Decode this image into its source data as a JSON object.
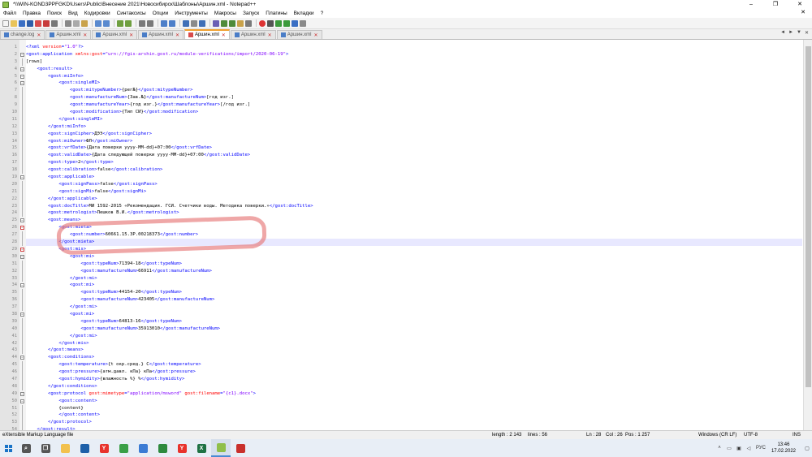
{
  "window": {
    "title": "*\\\\WIN-KOND3PPFGKD\\Users\\Public\\Внесение 2021\\Новосибирск\\Шаблоны\\Аршин.xml - Notepad++",
    "controls": [
      "–",
      "❐",
      "✕"
    ]
  },
  "menu": [
    "Файл",
    "Правка",
    "Поиск",
    "Вид",
    "Кодировки",
    "Синтаксисы",
    "Опции",
    "Инструменты",
    "Макросы",
    "Запуск",
    "Плагины",
    "Вкладки",
    "?"
  ],
  "menu_close": "✕",
  "tabs": [
    {
      "label": "change.log"
    },
    {
      "label": "Аршин.xml"
    },
    {
      "label": "Аршин.xml"
    },
    {
      "label": "Аршин.xml"
    },
    {
      "label": "Аршин.xml"
    },
    {
      "label": "Аршин.xml"
    },
    {
      "label": "Аршин.xml"
    }
  ],
  "tab_nav": [
    "◄",
    "►",
    "▼",
    "✕"
  ],
  "code_lines": [
    {
      "n": "1",
      "tokens": [
        {
          "c": "tag",
          "t": "<?xml "
        },
        {
          "c": "attr",
          "t": "version"
        },
        {
          "c": "tag",
          "t": "="
        },
        {
          "c": "val",
          "t": "\"1.0\""
        },
        {
          "c": "tag",
          "t": "?>"
        }
      ]
    },
    {
      "n": "2",
      "tokens": [
        {
          "c": "tag",
          "t": "<gost:application "
        },
        {
          "c": "attr",
          "t": "xmlns:gost"
        },
        {
          "c": "tag",
          "t": "="
        },
        {
          "c": "val",
          "t": "\"urn://fgis-arshin.gost.ru/module-verifications/import/2020-06-19\""
        },
        {
          "c": "tag",
          "t": ">"
        }
      ]
    },
    {
      "n": "3",
      "tokens": [
        {
          "c": "txt",
          "t": "[rows]"
        }
      ]
    },
    {
      "n": "4",
      "tokens": [
        {
          "c": "txt",
          "t": "    "
        },
        {
          "c": "tag",
          "t": "<gost:result>"
        }
      ]
    },
    {
      "n": "5",
      "tokens": [
        {
          "c": "txt",
          "t": "        "
        },
        {
          "c": "tag",
          "t": "<gost:miInfo>"
        }
      ]
    },
    {
      "n": "6",
      "tokens": [
        {
          "c": "txt",
          "t": "            "
        },
        {
          "c": "tag",
          "t": "<gost:singleMI>"
        }
      ]
    },
    {
      "n": "7",
      "tokens": [
        {
          "c": "txt",
          "t": "                "
        },
        {
          "c": "tag",
          "t": "<gost:mitypeNumber>"
        },
        {
          "c": "txt",
          "t": "{рег№}"
        },
        {
          "c": "tag",
          "t": "</gost:mitypeNumber>"
        }
      ]
    },
    {
      "n": "8",
      "tokens": [
        {
          "c": "txt",
          "t": "                "
        },
        {
          "c": "tag",
          "t": "<gost:manufactureNum>"
        },
        {
          "c": "txt",
          "t": "{Зав.№}"
        },
        {
          "c": "tag",
          "t": "</gost:manufactureNum>"
        },
        {
          "c": "txt",
          "t": "[год изг.]"
        }
      ]
    },
    {
      "n": "9",
      "tokens": [
        {
          "c": "txt",
          "t": "                "
        },
        {
          "c": "tag",
          "t": "<gost:manufactureYear>"
        },
        {
          "c": "txt",
          "t": "{год изг.}"
        },
        {
          "c": "tag",
          "t": "</gost:manufactureYear>"
        },
        {
          "c": "txt",
          "t": "[/год изг.]"
        }
      ]
    },
    {
      "n": "10",
      "tokens": [
        {
          "c": "txt",
          "t": "                "
        },
        {
          "c": "tag",
          "t": "<gost:modification>"
        },
        {
          "c": "txt",
          "t": "{Тип СИ}"
        },
        {
          "c": "tag",
          "t": "</gost:modification>"
        }
      ]
    },
    {
      "n": "11",
      "tokens": [
        {
          "c": "txt",
          "t": "            "
        },
        {
          "c": "tag",
          "t": "</gost:singleMI>"
        }
      ]
    },
    {
      "n": "12",
      "tokens": [
        {
          "c": "txt",
          "t": "        "
        },
        {
          "c": "tag",
          "t": "</gost:miInfo>"
        }
      ]
    },
    {
      "n": "13",
      "tokens": [
        {
          "c": "txt",
          "t": "        "
        },
        {
          "c": "tag",
          "t": "<gost:signCipher>"
        },
        {
          "c": "txt",
          "t": "ДЭЭ"
        },
        {
          "c": "tag",
          "t": "</gost:signCipher>"
        }
      ]
    },
    {
      "n": "14",
      "tokens": [
        {
          "c": "txt",
          "t": "        "
        },
        {
          "c": "tag",
          "t": "<gost:miOwner>"
        },
        {
          "c": "txt",
          "t": "ФЛ"
        },
        {
          "c": "tag",
          "t": "</gost:miOwner>"
        }
      ]
    },
    {
      "n": "15",
      "tokens": [
        {
          "c": "txt",
          "t": "        "
        },
        {
          "c": "tag",
          "t": "<gost:vrfDate>"
        },
        {
          "c": "txt",
          "t": "{Дата поверки yyyy-MM-dd}+07:00"
        },
        {
          "c": "tag",
          "t": "</gost:vrfDate>"
        }
      ]
    },
    {
      "n": "16",
      "tokens": [
        {
          "c": "txt",
          "t": "        "
        },
        {
          "c": "tag",
          "t": "<gost:validDate>"
        },
        {
          "c": "txt",
          "t": "{Дата следующей поверки yyyy-MM-dd}+07:00"
        },
        {
          "c": "tag",
          "t": "</gost:validDate>"
        }
      ]
    },
    {
      "n": "17",
      "tokens": [
        {
          "c": "txt",
          "t": "        "
        },
        {
          "c": "tag",
          "t": "<gost:type>"
        },
        {
          "c": "txt",
          "t": "2"
        },
        {
          "c": "tag",
          "t": "</gost:type>"
        }
      ]
    },
    {
      "n": "18",
      "tokens": [
        {
          "c": "txt",
          "t": "        "
        },
        {
          "c": "tag",
          "t": "<gost:calibration>"
        },
        {
          "c": "txt",
          "t": "false"
        },
        {
          "c": "tag",
          "t": "</gost:calibration>"
        }
      ]
    },
    {
      "n": "19",
      "tokens": [
        {
          "c": "txt",
          "t": "        "
        },
        {
          "c": "tag",
          "t": "<gost:applicable>"
        }
      ]
    },
    {
      "n": "20",
      "tokens": [
        {
          "c": "txt",
          "t": "            "
        },
        {
          "c": "tag",
          "t": "<gost:signPass>"
        },
        {
          "c": "txt",
          "t": "false"
        },
        {
          "c": "tag",
          "t": "</gost:signPass>"
        }
      ]
    },
    {
      "n": "21",
      "tokens": [
        {
          "c": "txt",
          "t": "            "
        },
        {
          "c": "tag",
          "t": "<gost:signMi>"
        },
        {
          "c": "txt",
          "t": "false"
        },
        {
          "c": "tag",
          "t": "</gost:signMi>"
        }
      ]
    },
    {
      "n": "22",
      "tokens": [
        {
          "c": "txt",
          "t": "        "
        },
        {
          "c": "tag",
          "t": "</gost:applicable>"
        }
      ]
    },
    {
      "n": "23",
      "tokens": [
        {
          "c": "txt",
          "t": "        "
        },
        {
          "c": "tag",
          "t": "<gost:docTitle>"
        },
        {
          "c": "txt",
          "t": "МИ 1592-2015 «Рекомендация. ГСИ. Счетчики воды. Методика поверки.»"
        },
        {
          "c": "tag",
          "t": "</gost:docTitle>"
        }
      ]
    },
    {
      "n": "24",
      "tokens": [
        {
          "c": "txt",
          "t": "        "
        },
        {
          "c": "tag",
          "t": "<gost:metrologist>"
        },
        {
          "c": "txt",
          "t": "Пешков В.И."
        },
        {
          "c": "tag",
          "t": "</gost:metrologist>"
        }
      ]
    },
    {
      "n": "25",
      "tokens": [
        {
          "c": "txt",
          "t": "        "
        },
        {
          "c": "tag",
          "t": "<gost:means>"
        }
      ]
    },
    {
      "n": "26",
      "tokens": [
        {
          "c": "txt",
          "t": "            "
        },
        {
          "c": "tag",
          "t": "<gost:mieta>"
        }
      ]
    },
    {
      "n": "27",
      "tokens": [
        {
          "c": "txt",
          "t": "                "
        },
        {
          "c": "tag",
          "t": "<gost:number>"
        },
        {
          "c": "txt",
          "t": "60661.15.3Р.00218373"
        },
        {
          "c": "tag",
          "t": "</gost:number>"
        }
      ]
    },
    {
      "n": "28",
      "current": true,
      "tokens": [
        {
          "c": "txt",
          "t": "            "
        },
        {
          "c": "tag",
          "t": "</gost:mieta>"
        }
      ]
    },
    {
      "n": "29",
      "tokens": [
        {
          "c": "txt",
          "t": "            "
        },
        {
          "c": "tag",
          "t": "<gost:mis>"
        }
      ]
    },
    {
      "n": "30",
      "tokens": [
        {
          "c": "txt",
          "t": "                "
        },
        {
          "c": "tag",
          "t": "<gost:mi>"
        }
      ]
    },
    {
      "n": "31",
      "tokens": [
        {
          "c": "txt",
          "t": "                    "
        },
        {
          "c": "tag",
          "t": "<gost:typeNum>"
        },
        {
          "c": "txt",
          "t": "71394-18"
        },
        {
          "c": "tag",
          "t": "</gost:typeNum>"
        }
      ]
    },
    {
      "n": "32",
      "tokens": [
        {
          "c": "txt",
          "t": "                    "
        },
        {
          "c": "tag",
          "t": "<gost:manufactureNum>"
        },
        {
          "c": "txt",
          "t": "66911"
        },
        {
          "c": "tag",
          "t": "</gost:manufactureNum>"
        }
      ]
    },
    {
      "n": "33",
      "tokens": [
        {
          "c": "txt",
          "t": "                "
        },
        {
          "c": "tag",
          "t": "</gost:mi>"
        }
      ]
    },
    {
      "n": "34",
      "tokens": [
        {
          "c": "txt",
          "t": "                "
        },
        {
          "c": "tag",
          "t": "<gost:mi>"
        }
      ]
    },
    {
      "n": "35",
      "tokens": [
        {
          "c": "txt",
          "t": "                    "
        },
        {
          "c": "tag",
          "t": "<gost:typeNum>"
        },
        {
          "c": "txt",
          "t": "44154-20"
        },
        {
          "c": "tag",
          "t": "</gost:typeNum>"
        }
      ]
    },
    {
      "n": "36",
      "tokens": [
        {
          "c": "txt",
          "t": "                    "
        },
        {
          "c": "tag",
          "t": "<gost:manufactureNum>"
        },
        {
          "c": "txt",
          "t": "423405"
        },
        {
          "c": "tag",
          "t": "</gost:manufactureNum>"
        }
      ]
    },
    {
      "n": "37",
      "tokens": [
        {
          "c": "txt",
          "t": "                "
        },
        {
          "c": "tag",
          "t": "</gost:mi>"
        }
      ]
    },
    {
      "n": "38",
      "tokens": [
        {
          "c": "txt",
          "t": "                "
        },
        {
          "c": "tag",
          "t": "<gost:mi>"
        }
      ]
    },
    {
      "n": "39",
      "tokens": [
        {
          "c": "txt",
          "t": "                    "
        },
        {
          "c": "tag",
          "t": "<gost:typeNum>"
        },
        {
          "c": "txt",
          "t": "64813-16"
        },
        {
          "c": "tag",
          "t": "</gost:typeNum>"
        }
      ]
    },
    {
      "n": "40",
      "tokens": [
        {
          "c": "txt",
          "t": "                    "
        },
        {
          "c": "tag",
          "t": "<gost:manufactureNum>"
        },
        {
          "c": "txt",
          "t": "35913010"
        },
        {
          "c": "tag",
          "t": "</gost:manufactureNum>"
        }
      ]
    },
    {
      "n": "41",
      "tokens": [
        {
          "c": "txt",
          "t": "                "
        },
        {
          "c": "tag",
          "t": "</gost:mi>"
        }
      ]
    },
    {
      "n": "42",
      "tokens": [
        {
          "c": "txt",
          "t": "            "
        },
        {
          "c": "tag",
          "t": "</gost:mis>"
        }
      ]
    },
    {
      "n": "43",
      "tokens": [
        {
          "c": "txt",
          "t": "        "
        },
        {
          "c": "tag",
          "t": "</gost:means>"
        }
      ]
    },
    {
      "n": "44",
      "tokens": [
        {
          "c": "txt",
          "t": "        "
        },
        {
          "c": "tag",
          "t": "<gost:conditions>"
        }
      ]
    },
    {
      "n": "45",
      "tokens": [
        {
          "c": "txt",
          "t": "            "
        },
        {
          "c": "tag",
          "t": "<gost:temperature>"
        },
        {
          "c": "txt",
          "t": "{t окр.сред.} C"
        },
        {
          "c": "tag",
          "t": "</gost:temperature>"
        }
      ]
    },
    {
      "n": "46",
      "tokens": [
        {
          "c": "txt",
          "t": "            "
        },
        {
          "c": "tag",
          "t": "<gost:pressure>"
        },
        {
          "c": "txt",
          "t": "{атм.давл. кПа} кПа"
        },
        {
          "c": "tag",
          "t": "</gost:pressure>"
        }
      ]
    },
    {
      "n": "47",
      "tokens": [
        {
          "c": "txt",
          "t": "            "
        },
        {
          "c": "tag",
          "t": "<gost:hymidity>"
        },
        {
          "c": "txt",
          "t": "{влажность %} %"
        },
        {
          "c": "tag",
          "t": "</gost:hymidity>"
        }
      ]
    },
    {
      "n": "48",
      "tokens": [
        {
          "c": "txt",
          "t": "        "
        },
        {
          "c": "tag",
          "t": "</gost:conditions>"
        }
      ]
    },
    {
      "n": "49",
      "tokens": [
        {
          "c": "txt",
          "t": "        "
        },
        {
          "c": "tag",
          "t": "<gost:protocol "
        },
        {
          "c": "attr",
          "t": "gost:mimetype"
        },
        {
          "c": "tag",
          "t": "="
        },
        {
          "c": "val",
          "t": "\"application/msword\""
        },
        {
          "c": "tag",
          "t": " "
        },
        {
          "c": "attr",
          "t": "gost:filename"
        },
        {
          "c": "tag",
          "t": "="
        },
        {
          "c": "val",
          "t": "\"{c1}.docx\""
        },
        {
          "c": "tag",
          "t": ">"
        }
      ]
    },
    {
      "n": "50",
      "tokens": [
        {
          "c": "txt",
          "t": "            "
        },
        {
          "c": "tag",
          "t": "<gost:content>"
        }
      ]
    },
    {
      "n": "51",
      "tokens": [
        {
          "c": "txt",
          "t": "            {content}"
        }
      ]
    },
    {
      "n": "52",
      "tokens": [
        {
          "c": "txt",
          "t": "            "
        },
        {
          "c": "tag",
          "t": "</gost:content>"
        }
      ]
    },
    {
      "n": "53",
      "tokens": [
        {
          "c": "txt",
          "t": "        "
        },
        {
          "c": "tag",
          "t": "</gost:protocol>"
        }
      ]
    },
    {
      "n": "54",
      "tokens": [
        {
          "c": "txt",
          "t": "    "
        },
        {
          "c": "tag",
          "t": "</gost:result>"
        }
      ]
    }
  ],
  "status": {
    "language": "eXtensible Markup Language file",
    "length": "length : 2 143",
    "lines": "lines : 56",
    "ln": "Ln : 28",
    "col": "Col : 26",
    "pos": "Pos : 1 257",
    "eol": "Windows (CR LF)",
    "encoding": "UTF-8",
    "mode": "INS"
  },
  "taskbar": {
    "apps": [
      {
        "name": "search",
        "glyph": "⌕",
        "color": "#555555"
      },
      {
        "name": "task-view",
        "glyph": "❐",
        "color": "#555555"
      },
      {
        "name": "file-explorer",
        "glyph": "",
        "color": "#f2c14e"
      },
      {
        "name": "mail",
        "glyph": "",
        "color": "#1d5fa8"
      },
      {
        "name": "yandex-browser",
        "glyph": "Y",
        "color": "#e8322c"
      },
      {
        "name": "chrome",
        "glyph": "",
        "color": "#3a9f47"
      },
      {
        "name": "network",
        "glyph": "",
        "color": "#3b7bd4"
      },
      {
        "name": "settings",
        "glyph": "",
        "color": "#2d8a3e"
      },
      {
        "name": "yandex",
        "glyph": "Y",
        "color": "#e8322c"
      },
      {
        "name": "excel",
        "glyph": "X",
        "color": "#1f7244"
      },
      {
        "name": "notepad-plus-plus",
        "glyph": "",
        "color": "#8fbf4a",
        "active": true
      },
      {
        "name": "pdf-reader",
        "glyph": "",
        "color": "#c9302c"
      }
    ],
    "tray_language": "РУС",
    "time": "13:46",
    "date": "17.02.2022"
  },
  "colors": {
    "xml_tag": "#0000ff",
    "xml_attr": "#ff0000",
    "xml_value": "#8000ff",
    "current_line": "#e8e8ff",
    "annotation": "#e67878"
  }
}
